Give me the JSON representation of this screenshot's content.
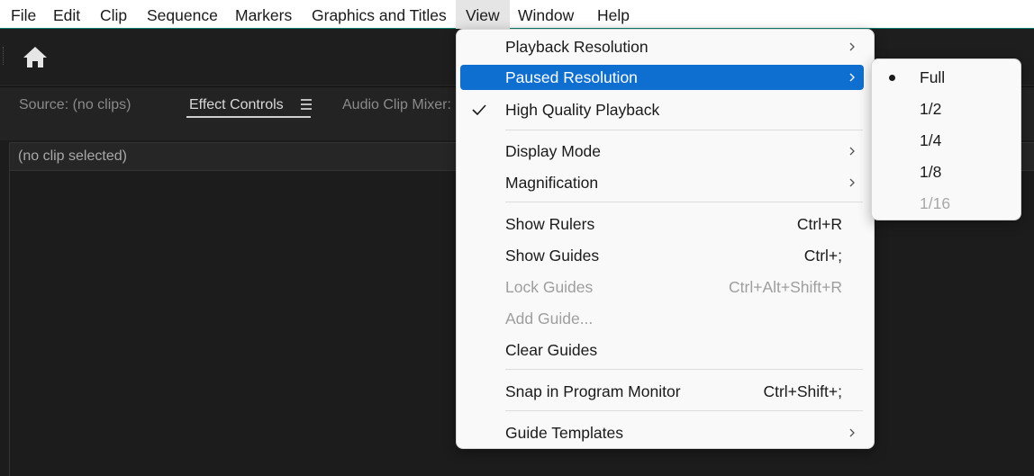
{
  "menubar": {
    "items": [
      {
        "label": "File"
      },
      {
        "label": "Edit"
      },
      {
        "label": "Clip"
      },
      {
        "label": "Sequence"
      },
      {
        "label": "Markers"
      },
      {
        "label": "Graphics and Titles"
      },
      {
        "label": "View"
      },
      {
        "label": "Window"
      },
      {
        "label": "Help"
      }
    ]
  },
  "toolbar": {
    "home_icon": "home-icon"
  },
  "panel": {
    "tabs": [
      {
        "label": "Source: (no clips)"
      },
      {
        "label": "Effect Controls"
      },
      {
        "label": "Audio Clip Mixer:"
      }
    ],
    "clip_status": "(no clip selected)"
  },
  "view_menu": {
    "items": [
      {
        "label": "Playback Resolution",
        "shortcut": "",
        "submenu": true
      },
      {
        "label": "Paused Resolution",
        "shortcut": "",
        "submenu": true,
        "highlighted": true
      },
      {
        "label": "High Quality Playback",
        "shortcut": "",
        "checked": true
      },
      {
        "label": "Display Mode",
        "shortcut": "",
        "submenu": true
      },
      {
        "label": "Magnification",
        "shortcut": "",
        "submenu": true
      },
      {
        "label": "Show Rulers",
        "shortcut": "Ctrl+R"
      },
      {
        "label": "Show Guides",
        "shortcut": "Ctrl+;"
      },
      {
        "label": "Lock Guides",
        "shortcut": "Ctrl+Alt+Shift+R",
        "disabled": true
      },
      {
        "label": "Add Guide...",
        "shortcut": "",
        "disabled": true
      },
      {
        "label": "Clear Guides",
        "shortcut": ""
      },
      {
        "label": "Snap in Program Monitor",
        "shortcut": "Ctrl+Shift+;"
      },
      {
        "label": "Guide Templates",
        "shortcut": "",
        "submenu": true
      }
    ]
  },
  "paused_resolution_submenu": {
    "items": [
      {
        "label": "Full",
        "selected": true
      },
      {
        "label": "1/2"
      },
      {
        "label": "1/4"
      },
      {
        "label": "1/8"
      },
      {
        "label": "1/16",
        "disabled": true
      }
    ]
  },
  "colors": {
    "highlight": "#0f6fd0",
    "panel_bg": "#232323",
    "menu_bg": "#f9f9f9"
  }
}
